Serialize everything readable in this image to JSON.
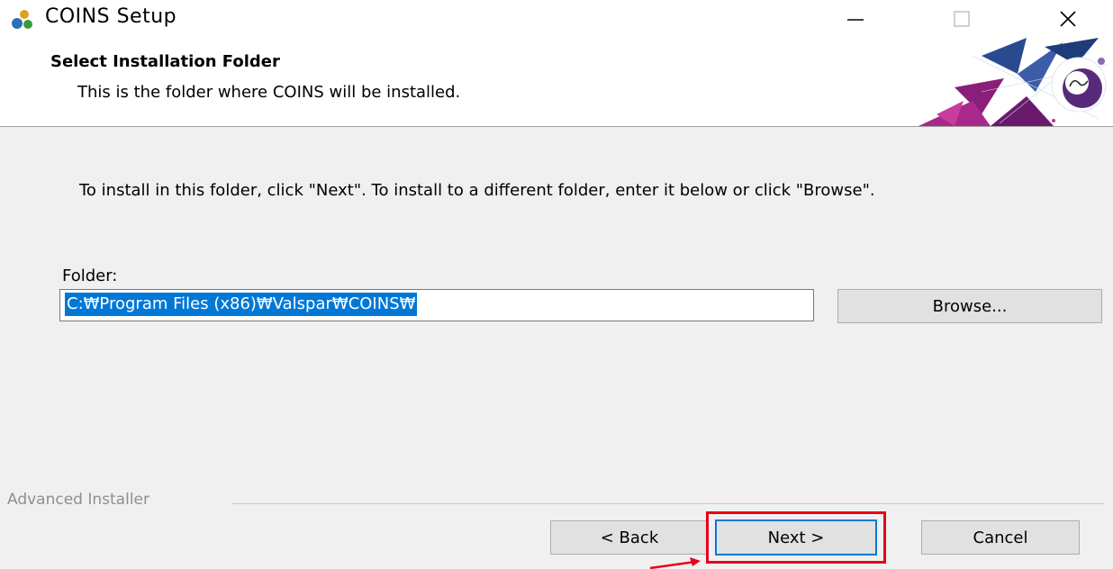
{
  "window": {
    "title": "COINS Setup",
    "controls": {
      "minimize": "minimize-icon",
      "maximize": "maximize-icon",
      "close": "close-icon"
    }
  },
  "header": {
    "title": "Select Installation Folder",
    "subtitle": "This is the folder where COINS will be installed."
  },
  "body": {
    "instruction": "To install in this folder, click \"Next\". To install to a different folder, enter it below or click \"Browse\".",
    "folder_label": "Folder:",
    "folder_value": "C:₩Program Files (x86)₩Valspar₩COINS₩",
    "browse_label": "Browse..."
  },
  "footer": {
    "brand": "Advanced Installer",
    "back_label": "< Back",
    "next_label": "Next >",
    "cancel_label": "Cancel"
  },
  "colors": {
    "selection": "#0078d7",
    "highlight_box": "#e8001c",
    "banner_magenta": "#8a1f7a",
    "banner_blue": "#2a4a8f"
  }
}
